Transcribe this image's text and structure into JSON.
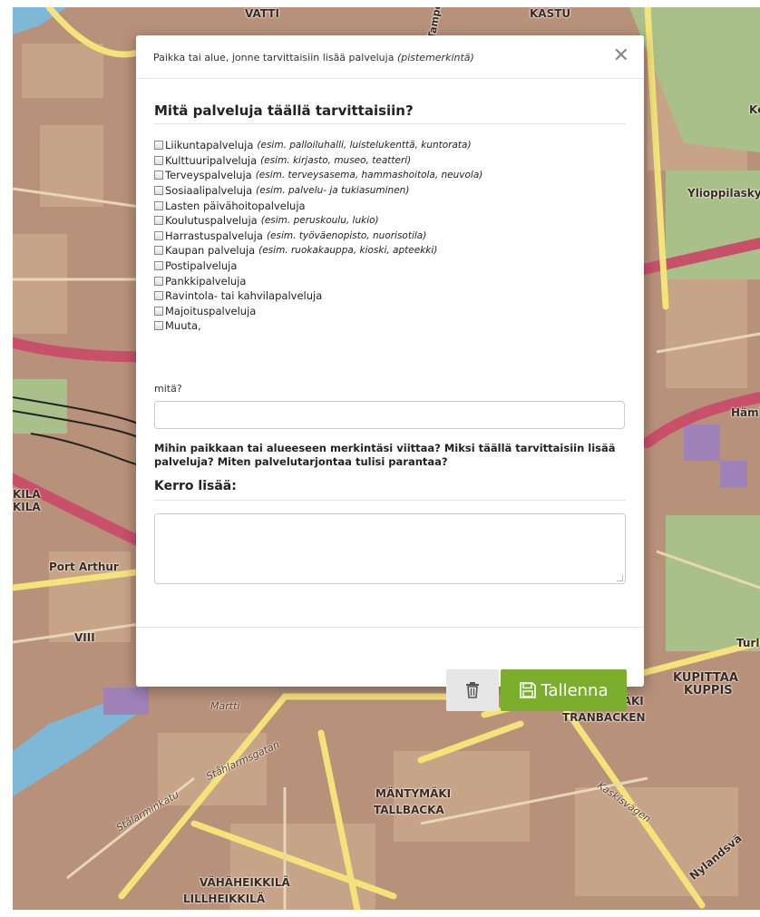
{
  "map": {
    "labels": [
      "VATTI",
      "Tampere",
      "KASTU",
      "Ylioppilasky",
      "Kc",
      "Port Arthur",
      "VIII",
      "KILA",
      "KILA",
      "Hämi",
      "Turl",
      "KUPITTAA",
      "KUPPIS",
      "KURJENMÄKI",
      "TRANBACKEN",
      "MÄNTYMÄKI",
      "TALLBACKA",
      "VÄHÄHEIKKILÄ",
      "LILLHEIKKILÄ",
      "Martti",
      "Kaskisvägen",
      "Stålarminkatu",
      "Ståhlarmsgatan",
      "Nylandsvä"
    ]
  },
  "modal": {
    "title": "Paikka tai alue, jonne tarvittaisiin lisää palveluja ",
    "title_note": "(pistemerkintä)",
    "close_symbol": "✕",
    "question": "Mitä palveluja täällä tarvittaisiin?",
    "options": [
      {
        "label": "Liikuntapalveluja",
        "note": "(esim. palloiluhalli, luistelukenttä, kuntorata)"
      },
      {
        "label": "Kulttuuripalveluja",
        "note": "(esim. kirjasto, museo, teatteri)"
      },
      {
        "label": "Terveyspalveluja",
        "note": "(esim. terveysasema, hammashoitola, neuvola)"
      },
      {
        "label": "Sosiaalipalveluja",
        "note": "(esim. palvelu- ja tukiasuminen)"
      },
      {
        "label": "Lasten päivähoitopalveluja",
        "note": ""
      },
      {
        "label": "Koulutuspalveluja",
        "note": "(esim. peruskoulu, lukio)"
      },
      {
        "label": "Harrastuspalveluja",
        "note": "(esim. työväenopisto, nuorisotila)"
      },
      {
        "label": "Kaupan palveluja",
        "note": "(esim. ruokakauppa, kioski, apteekki)"
      },
      {
        "label": "Postipalveluja",
        "note": ""
      },
      {
        "label": "Pankkipalveluja",
        "note": ""
      },
      {
        "label": "Ravintola- tai kahvilapalveluja",
        "note": ""
      },
      {
        "label": "Majoituspalveluja",
        "note": ""
      },
      {
        "label": "Muuta,",
        "note": ""
      }
    ],
    "other_label": "mitä?",
    "other_value": "",
    "prompt": "Mihin paikkaan tai alueeseen merkintäsi viittaa? Miksi täällä tarvittaisiin lisää palveluja? Miten palvelutarjontaa tulisi parantaa?",
    "tell_more": "Kerro lisää:",
    "tell_more_value": "",
    "delete_icon": "trash-icon",
    "save_icon": "floppy-disk-icon",
    "save_label": "Tallenna",
    "save_color": "#7cae2d"
  }
}
